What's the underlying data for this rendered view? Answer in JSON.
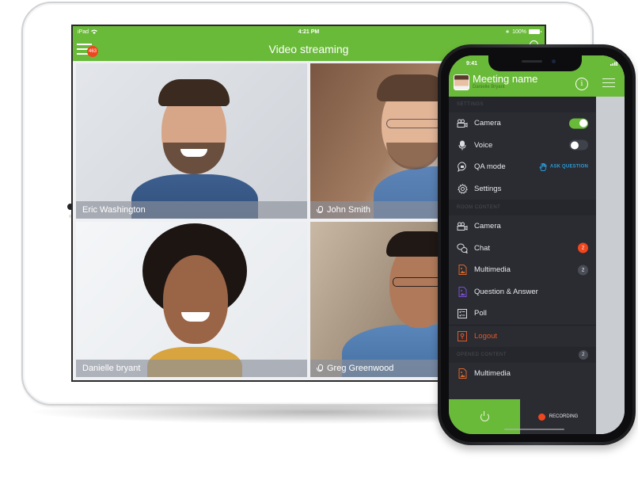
{
  "tablet": {
    "status_bar": {
      "carrier": "iPad",
      "time": "4:21 PM",
      "battery": "100%"
    },
    "header": {
      "title": "Video streaming",
      "notification_count": "463"
    },
    "participants": [
      {
        "name": "Eric Washington",
        "muted_icon": false
      },
      {
        "name": "John Smith",
        "muted_icon": true
      },
      {
        "name": "Danielle bryant",
        "muted_icon": false
      },
      {
        "name": "Greg Greenwood",
        "muted_icon": true
      }
    ]
  },
  "phone": {
    "status_bar": {
      "time": "9:41"
    },
    "header": {
      "meeting_name": "Meeting name",
      "user_name": "Danielle Bryant",
      "info_icon": "i"
    },
    "settings": {
      "label": "SETTINGS",
      "items": [
        {
          "label": "Camera",
          "icon": "camera-icon",
          "toggle": "on"
        },
        {
          "label": "Voice",
          "icon": "microphone-icon",
          "toggle": "off"
        },
        {
          "label": "QA mode",
          "icon": "chat-bubble-icon",
          "action": "ASK QUESTION"
        },
        {
          "label": "Settings",
          "icon": "gear-icon"
        }
      ]
    },
    "room_content": {
      "label": "ROOM CONTENT",
      "items": [
        {
          "label": "Camera",
          "icon": "camera-icon"
        },
        {
          "label": "Chat",
          "icon": "chat-icon",
          "badge": "2"
        },
        {
          "label": "Multimedia",
          "icon": "multimedia-icon",
          "badge": "2"
        },
        {
          "label": "Question & Answer",
          "icon": "qa-icon"
        },
        {
          "label": "Poll",
          "icon": "poll-icon"
        }
      ]
    },
    "logout": {
      "label": "Logout"
    },
    "opened_content": {
      "label": "OPENED CONTENT",
      "count": "2",
      "items": [
        {
          "label": "Multimedia",
          "icon": "multimedia-icon"
        }
      ]
    },
    "bottom_bar": {
      "recording_label": "RECORDING"
    },
    "colors": {
      "accent": "#6aba3a",
      "drawer": "#2a2c32",
      "alert": "#f0461e",
      "link": "#2c9ad8",
      "logout": "#e0592b",
      "multimedia": "#d9662a",
      "qa": "#7a4fd1"
    }
  }
}
